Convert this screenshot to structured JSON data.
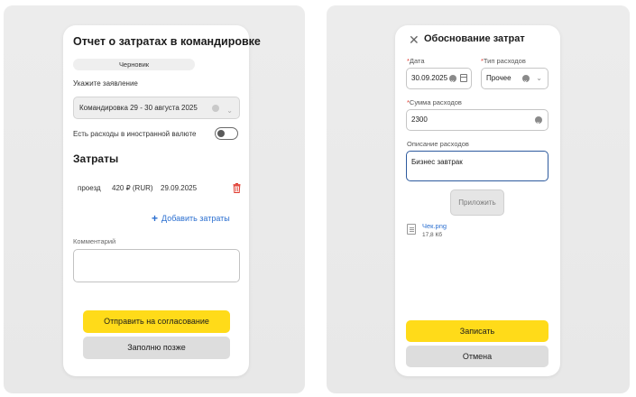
{
  "colors": {
    "accent_yellow": "#ffdb19",
    "secondary_gray": "#dddddd",
    "link_blue": "#2b6fd0",
    "required_red": "#e03a2f",
    "delete_red": "#e03a2f",
    "focus_border": "#2d5a9e"
  },
  "report": {
    "title": "Отчет о затратах в командировке",
    "status_badge": "Черновик",
    "application_label": "Укажите заявление",
    "application_value": "Командировка 29 - 30 августа 2025",
    "foreign_currency_label": "Есть расходы в иностранной валюте",
    "foreign_currency_enabled": false,
    "expenses_heading": "Затраты",
    "expenses": [
      {
        "type": "проезд",
        "amount": "420 ₽ (RUR)",
        "date": "29.09.2025"
      }
    ],
    "add_expense_label": "Добавить затраты",
    "comment_label": "Комментарий",
    "comment_value": "",
    "submit_label": "Отправить на согласование",
    "later_label": "Заполню позже",
    "icons": [
      "chevron-down-icon",
      "clear-icon",
      "trash-icon",
      "plus-icon"
    ]
  },
  "justification": {
    "title": "Обоснование затрат",
    "required_mark": "*",
    "date_label": "Дата",
    "date_value": "30.09.2025",
    "expense_type_label": "Тип расходов",
    "expense_type_value": "Прочее",
    "amount_label": "Сумма расходов",
    "amount_value": "2300",
    "description_label": "Описание расходов",
    "description_value": "Бизнес завтрак",
    "attach_label": "Приложить",
    "attachment": {
      "name": "Чек.png",
      "size": "17,8 Кб"
    },
    "save_label": "Записать",
    "cancel_label": "Отмена",
    "icons": [
      "close-icon",
      "calendar-icon",
      "clear-icon",
      "chevron-down-icon",
      "file-icon"
    ]
  }
}
